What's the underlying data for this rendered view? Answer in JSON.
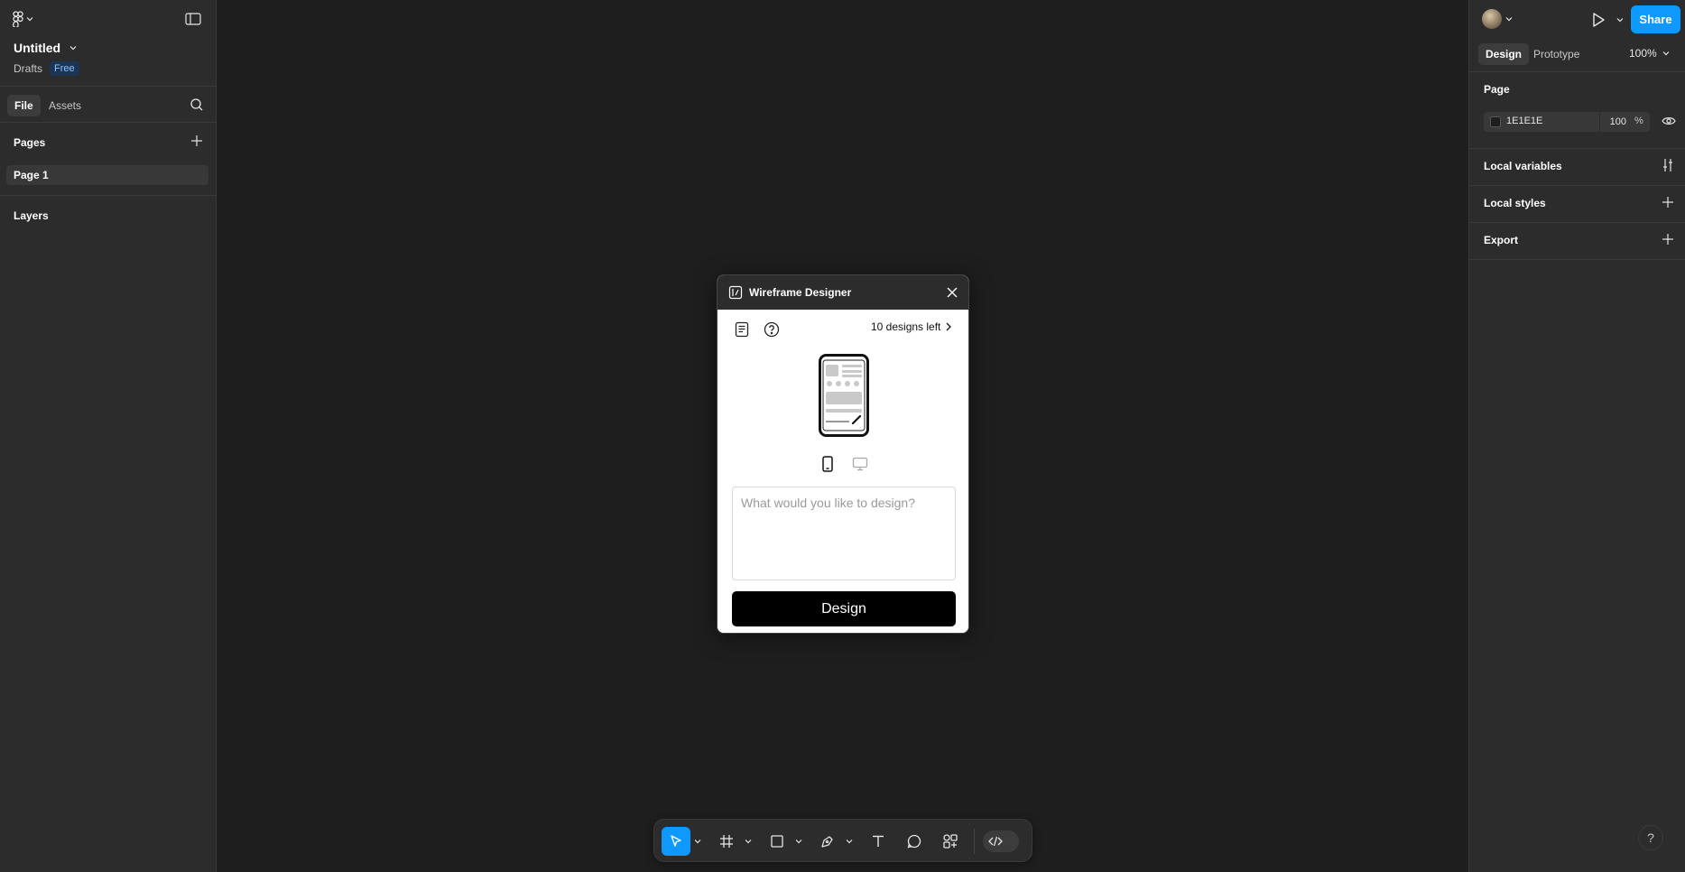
{
  "left_panel": {
    "file_name": "Untitled",
    "location": "Drafts",
    "plan_badge": "Free",
    "tabs": [
      {
        "label": "File",
        "active": true
      },
      {
        "label": "Assets",
        "active": false
      }
    ],
    "pages_header": "Pages",
    "pages": [
      {
        "label": "Page 1",
        "selected": true
      }
    ],
    "layers_header": "Layers"
  },
  "right_panel": {
    "share_label": "Share",
    "tabs": [
      {
        "label": "Design",
        "active": true
      },
      {
        "label": "Prototype",
        "active": false
      }
    ],
    "zoom": "100%",
    "page_section": {
      "title": "Page",
      "background_hex": "1E1E1E",
      "opacity": "100",
      "percent": "%"
    },
    "rows": [
      {
        "label": "Local variables",
        "icon": "variables-icon"
      },
      {
        "label": "Local styles",
        "icon": "plus-icon"
      },
      {
        "label": "Export",
        "icon": "plus-icon"
      }
    ]
  },
  "plugin": {
    "title": "Wireframe Designer",
    "designs_left": "10 designs left",
    "prompt_placeholder": "What would you like to design?",
    "design_button": "Design"
  },
  "help_label": "?",
  "colors": {
    "canvas": "#1e1e1e",
    "panel": "#2c2c2c",
    "accent": "#0d99ff",
    "plugin_button": "#000000"
  },
  "toolbar": {
    "tools": [
      "move-icon",
      "frame-icon",
      "rectangle-icon",
      "pen-icon",
      "text-icon",
      "comment-icon",
      "actions-icon",
      "dev-mode-icon"
    ],
    "active_tool": "move-icon"
  }
}
